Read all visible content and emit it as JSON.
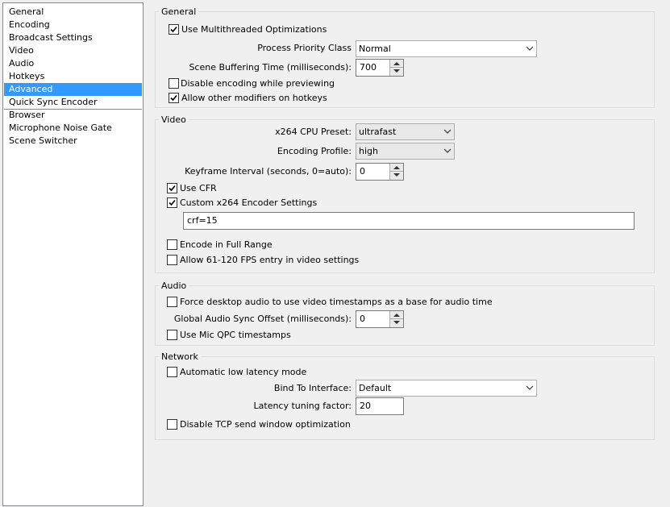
{
  "sidebar": {
    "items": [
      {
        "label": "General"
      },
      {
        "label": "Encoding"
      },
      {
        "label": "Broadcast Settings"
      },
      {
        "label": "Video"
      },
      {
        "label": "Audio"
      },
      {
        "label": "Hotkeys"
      },
      {
        "label": "Advanced",
        "selected": true
      },
      {
        "label": "Quick Sync Encoder"
      },
      {
        "label": "Browser"
      },
      {
        "label": "Microphone Noise Gate"
      },
      {
        "label": "Scene Switcher"
      }
    ]
  },
  "general": {
    "title": "General",
    "multithreaded_label": "Use Multithreaded Optimizations",
    "multithreaded_checked": true,
    "process_priority_label": "Process Priority Class",
    "process_priority_value": "Normal",
    "scene_buffering_label": "Scene Buffering Time (milliseconds):",
    "scene_buffering_value": "700",
    "disable_encoding_label": "Disable encoding while previewing",
    "disable_encoding_checked": false,
    "allow_modifiers_label": "Allow other modifiers on hotkeys",
    "allow_modifiers_checked": true
  },
  "video": {
    "title": "Video",
    "preset_label": "x264 CPU Preset:",
    "preset_value": "ultrafast",
    "profile_label": "Encoding Profile:",
    "profile_value": "high",
    "keyframe_label": "Keyframe Interval (seconds, 0=auto):",
    "keyframe_value": "0",
    "use_cfr_label": "Use CFR",
    "use_cfr_checked": true,
    "custom_x264_label": "Custom x264 Encoder Settings",
    "custom_x264_checked": true,
    "custom_x264_value": "crf=15",
    "full_range_label": "Encode in Full Range",
    "full_range_checked": false,
    "fps_entry_label": "Allow 61-120 FPS entry in video settings",
    "fps_entry_checked": false
  },
  "audio": {
    "title": "Audio",
    "force_desktop_label": "Force desktop audio to use video timestamps as a base for audio time",
    "force_desktop_checked": false,
    "sync_offset_label": "Global Audio Sync Offset (milliseconds):",
    "sync_offset_value": "0",
    "mic_qpc_label": "Use Mic QPC timestamps",
    "mic_qpc_checked": false
  },
  "network": {
    "title": "Network",
    "low_latency_label": "Automatic low latency mode",
    "low_latency_checked": false,
    "bind_label": "Bind To Interface:",
    "bind_value": "Default",
    "latency_factor_label": "Latency tuning factor:",
    "latency_factor_value": "20",
    "disable_tcp_label": "Disable TCP send window optimization",
    "disable_tcp_checked": false
  }
}
